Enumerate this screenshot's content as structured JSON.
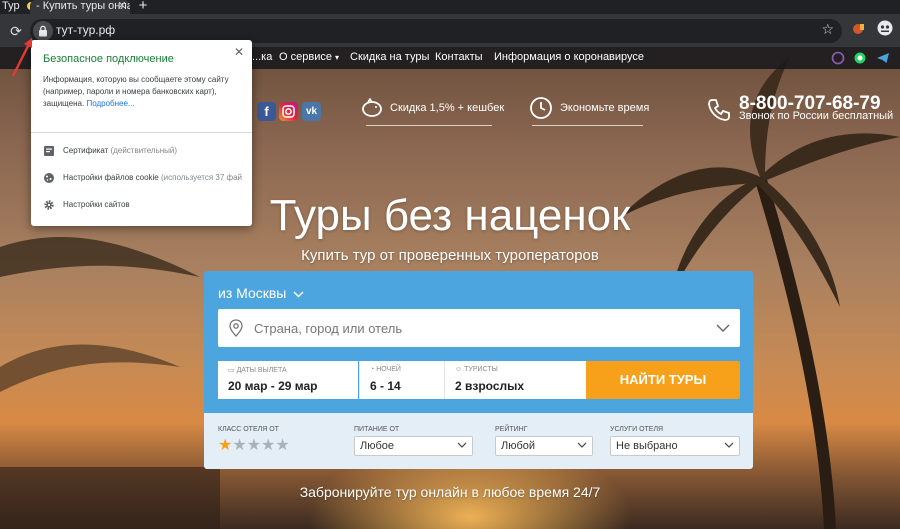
{
  "browser": {
    "prev_tab_label": "Тур",
    "active_tab_title": "- Купить туры онлайн",
    "new_tab_symbol": "+",
    "url": "тут-тур.рф"
  },
  "popup": {
    "title": "Безопасное подключение",
    "description": "Информация, которую вы сообщаете этому сайту (например, пароли и номера банковских карт), защищена.",
    "more_link": "Подробнее...",
    "items": [
      {
        "icon": "certificate-icon",
        "label": "Сертификат",
        "sub": "(действительный)"
      },
      {
        "icon": "cookie-icon",
        "label": "Настройки файлов cookie",
        "sub": "(используется 37 фай"
      },
      {
        "icon": "gear-icon",
        "label": "Настройки сайтов",
        "sub": ""
      }
    ]
  },
  "nav": {
    "items": [
      "...ка",
      "О сервисе",
      "Скидка на туры",
      "Контакты",
      "Информация о коронавирусе"
    ]
  },
  "header": {
    "cashback": "Скидка 1,5% + кешбек",
    "save_time": "Экономьте время",
    "phone": "8-800-707-68-79",
    "phone_note": "Звонок по России бесплатный"
  },
  "hero": {
    "title": "Туры без наценок",
    "subtitle": "Купить тур от проверенных туроператоров"
  },
  "search": {
    "origin": "из Москвы",
    "destination_placeholder": "Страна, город или отель",
    "dates": {
      "label": "Даты вылета",
      "value": "20 мар - 29 мар"
    },
    "nights": {
      "label": "Ночей",
      "value": "6 - 14"
    },
    "tourists": {
      "label": "Туристы",
      "value": "2 взрослых"
    },
    "find_button": "НАЙТИ ТУРЫ",
    "filters": {
      "hotel_class": {
        "label": "Класс отеля от",
        "stars_selected": 1,
        "stars_total": 5
      },
      "meal": {
        "label": "Питание от",
        "value": "Любое"
      },
      "rating": {
        "label": "Рейтинг",
        "value": "Любой"
      },
      "services": {
        "label": "Услуги отеля",
        "value": "Не выбрано"
      }
    }
  },
  "footer_text": "Забронируйте тур онлайн в любое время 24/7",
  "colors": {
    "panel_blue": "#4da5df",
    "button_orange": "#f7a11a",
    "secure_green": "#188038",
    "link_blue": "#1a73e8"
  }
}
